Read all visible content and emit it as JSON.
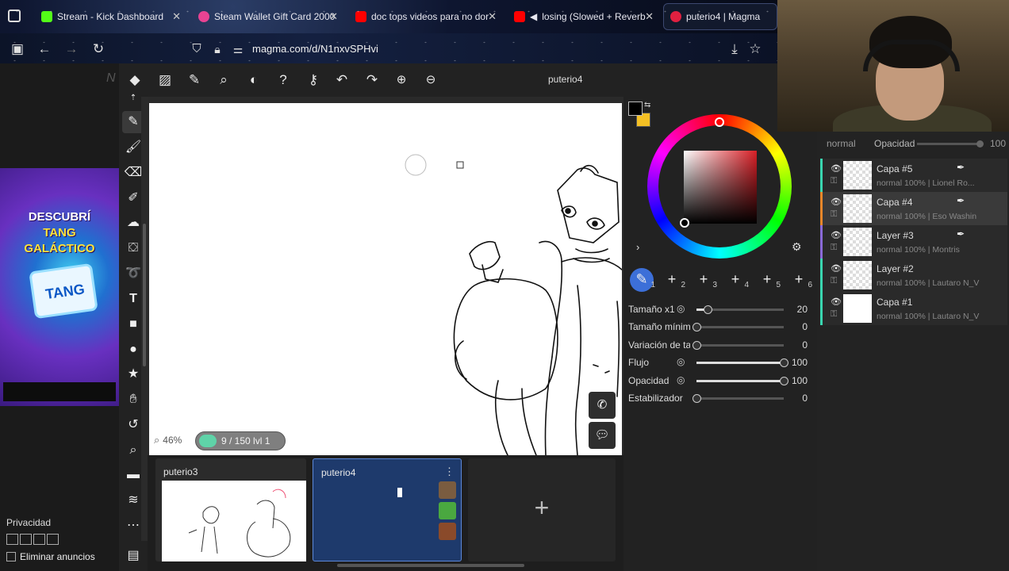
{
  "browser": {
    "tabs": [
      {
        "title": "Stream - Kick Dashboard",
        "color": "#53fc18"
      },
      {
        "title": "Steam Wallet Gift Card 2000",
        "color": "#e84393"
      },
      {
        "title": "doc tops videos para no dor",
        "color": "#ff0000"
      },
      {
        "title": "losing (Slowed + Reverb",
        "color": "#ff0000"
      },
      {
        "title": "puterio4 | Magma",
        "color": "#e02040"
      }
    ],
    "url": "magma.com/d/N1nxvSPHvi"
  },
  "magma": {
    "doc_title": "puterio4",
    "zoom": "46%",
    "lag": "9 / 150  lvl 1",
    "drawings": [
      {
        "name": "puterio3"
      },
      {
        "name": "puterio4"
      }
    ]
  },
  "ad": {
    "line1": "DESCUBRÍ",
    "line2": "TANG GALÁCTICO",
    "brand": "TANG"
  },
  "page": {
    "privacy": "Privacidad",
    "remove_ads": "Eliminar anuncios"
  },
  "brush": {
    "slots": [
      "1",
      "2",
      "3",
      "4",
      "5",
      "6"
    ],
    "rows": [
      {
        "label": "Tamaño x1",
        "value": "20",
        "level": 0.13,
        "dyn": true
      },
      {
        "label": "Tamaño mínimo",
        "value": "0",
        "level": 0,
        "dyn": false
      },
      {
        "label": "Variación de tamaño",
        "value": "0",
        "level": 0,
        "dyn": false
      },
      {
        "label": "Flujo",
        "value": "100",
        "level": 1,
        "dyn": true
      },
      {
        "label": "Opacidad",
        "value": "100",
        "level": 1,
        "dyn": true
      },
      {
        "label": "Estabilizador",
        "value": "0",
        "level": 0,
        "dyn": false
      }
    ],
    "colors": {
      "primary": "#000000",
      "secondary": "#f4c024",
      "hue": "#d81f26"
    }
  },
  "layers": {
    "mode": "normal",
    "opacity_label": "Opacidad",
    "opacity_value": "100",
    "items": [
      {
        "name": "Capa #5",
        "meta": "normal  100% | Lionel Ro...",
        "color": "#3ad6b0",
        "owner": true
      },
      {
        "name": "Capa #4",
        "meta": "normal  100% | Eso Washin",
        "color": "#e8872a",
        "owner": true
      },
      {
        "name": "Layer #3",
        "meta": "normal  100% | Montris",
        "color": "#8a6ad8",
        "owner": true
      },
      {
        "name": "Layer #2",
        "meta": "normal  100% | Lautaro N_V",
        "color": "#3ad6b0",
        "owner": false
      },
      {
        "name": "Capa #1",
        "meta": "normal  100% | Lautaro N_V",
        "color": "#3ad6b0",
        "owner": false
      }
    ]
  }
}
